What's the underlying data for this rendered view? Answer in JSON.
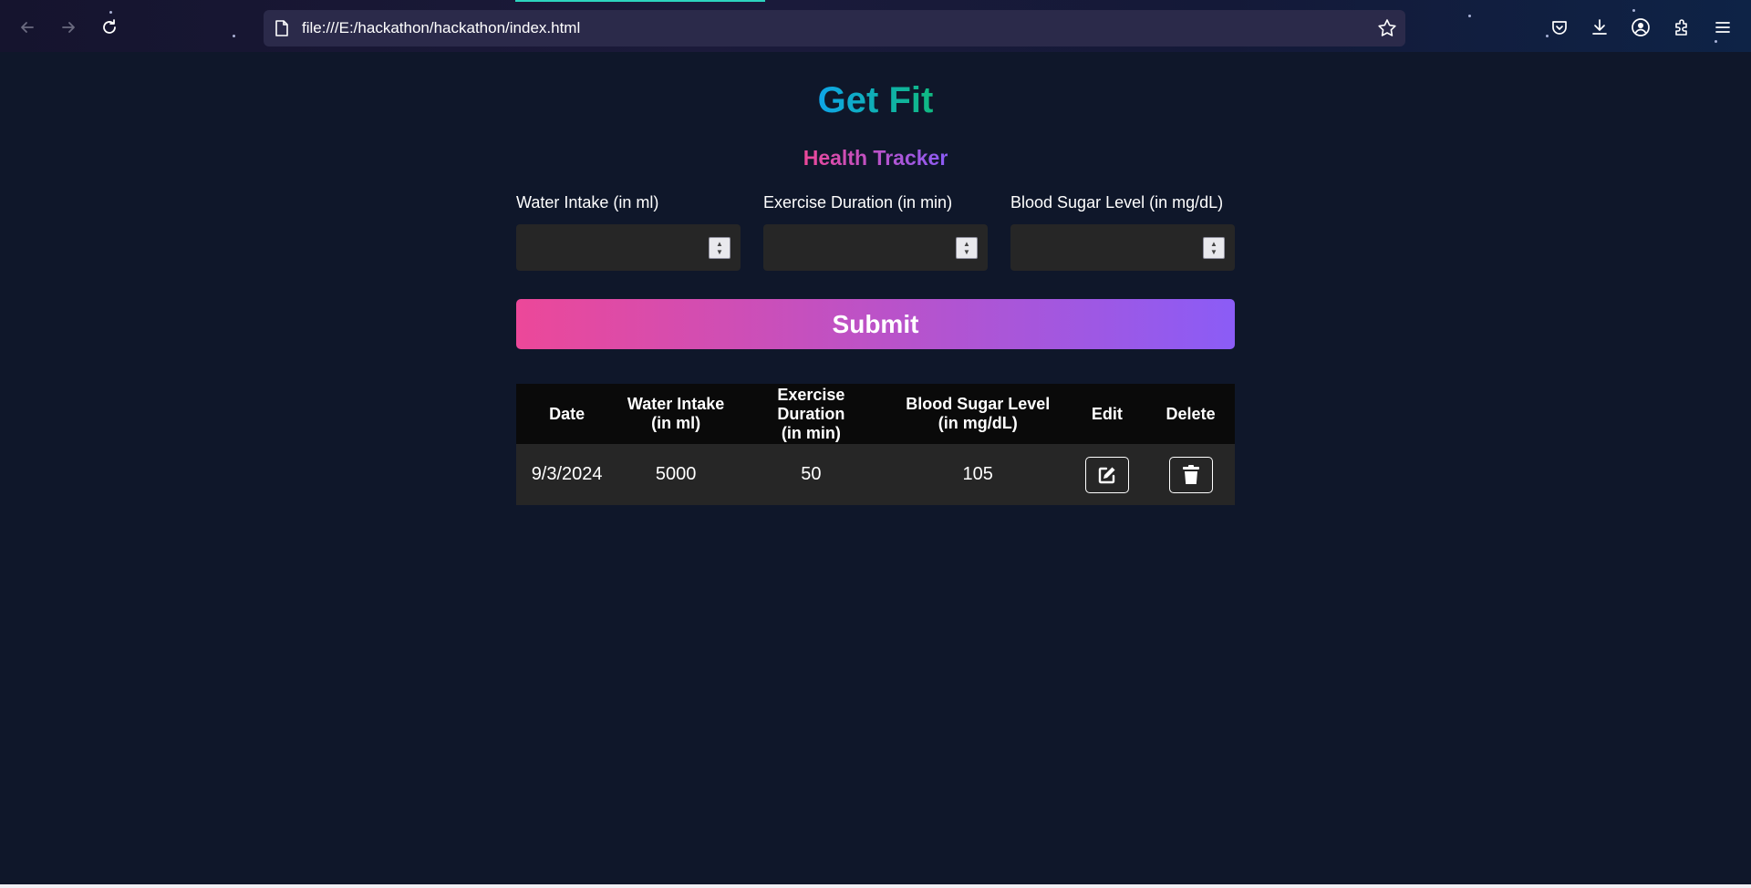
{
  "browser": {
    "url": "file:///E:/hackathon/hackathon/index.html",
    "icons": [
      "back-icon",
      "forward-icon",
      "reload-icon",
      "page-icon",
      "bookmark-star-icon",
      "pocket-icon",
      "download-icon",
      "account-icon",
      "extensions-icon",
      "menu-icon"
    ]
  },
  "header": {
    "title": "Get Fit",
    "subtitle": "Health Tracker",
    "title_gradient": [
      "#0ea5e9",
      "#10b981"
    ],
    "subtitle_gradient": [
      "#ec4899",
      "#8b5cf6"
    ]
  },
  "form": {
    "fields": [
      {
        "label": "Water Intake (in ml)",
        "value": ""
      },
      {
        "label": "Exercise Duration (in min)",
        "value": ""
      },
      {
        "label": "Blood Sugar Level (in mg/dL)",
        "value": ""
      }
    ],
    "submit_label": "Submit"
  },
  "table": {
    "headers": [
      [
        "Date"
      ],
      [
        "Water Intake",
        "(in ml)"
      ],
      [
        "Exercise Duration",
        "(in min)"
      ],
      [
        "Blood Sugar Level",
        "(in mg/dL)"
      ],
      [
        "Edit"
      ],
      [
        "Delete"
      ]
    ],
    "rows": [
      {
        "date": "9/3/2024",
        "water": "5000",
        "exercise": "50",
        "sugar": "105"
      }
    ]
  },
  "colors": {
    "background": "#0f172a",
    "input_bg": "#262626",
    "header_bg": "#0a0a0a"
  }
}
